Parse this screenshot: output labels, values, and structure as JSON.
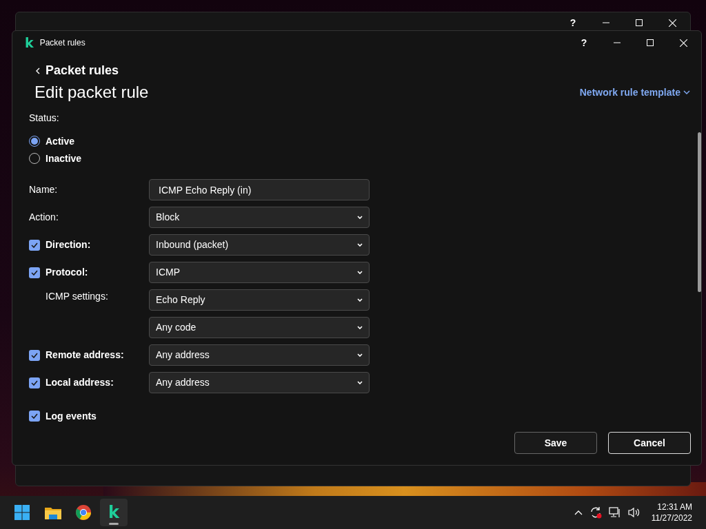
{
  "back_window": {
    "help": "?"
  },
  "window": {
    "app_letter": "k",
    "title": "Packet rules",
    "help": "?"
  },
  "breadcrumb": "Packet rules",
  "heading": "Edit packet rule",
  "template_link": "Network rule template",
  "status": {
    "label": "Status:",
    "options": [
      {
        "label": "Active",
        "selected": true
      },
      {
        "label": "Inactive",
        "selected": false
      }
    ]
  },
  "fields": [
    {
      "kind": "plain",
      "label": "Name:",
      "dropdown": false,
      "value": "ICMP Echo Reply (in)"
    },
    {
      "kind": "plain",
      "label": "Action:",
      "dropdown": true,
      "value": "Block"
    },
    {
      "kind": "check",
      "label": "Direction:",
      "checked": true,
      "dropdown": true,
      "value": "Inbound (packet)"
    },
    {
      "kind": "check",
      "label": "Protocol:",
      "checked": true,
      "dropdown": true,
      "value": "ICMP"
    },
    {
      "kind": "sub",
      "label": "ICMP settings:",
      "dropdown": true,
      "value": "Echo Reply"
    },
    {
      "kind": "none",
      "dropdown": true,
      "value": "Any code"
    },
    {
      "kind": "check",
      "label": "Remote address:",
      "checked": true,
      "dropdown": true,
      "value": "Any address"
    },
    {
      "kind": "check",
      "label": "Local address:",
      "checked": true,
      "dropdown": true,
      "value": "Any address"
    }
  ],
  "log_events": {
    "label": "Log events",
    "checked": true
  },
  "buttons": [
    {
      "label": "Save",
      "kind": "secondary"
    },
    {
      "label": "Cancel",
      "kind": "primary"
    }
  ],
  "taskbar": {
    "app_letter": "k",
    "time": "12:31 AM",
    "date": "11/27/2022"
  }
}
